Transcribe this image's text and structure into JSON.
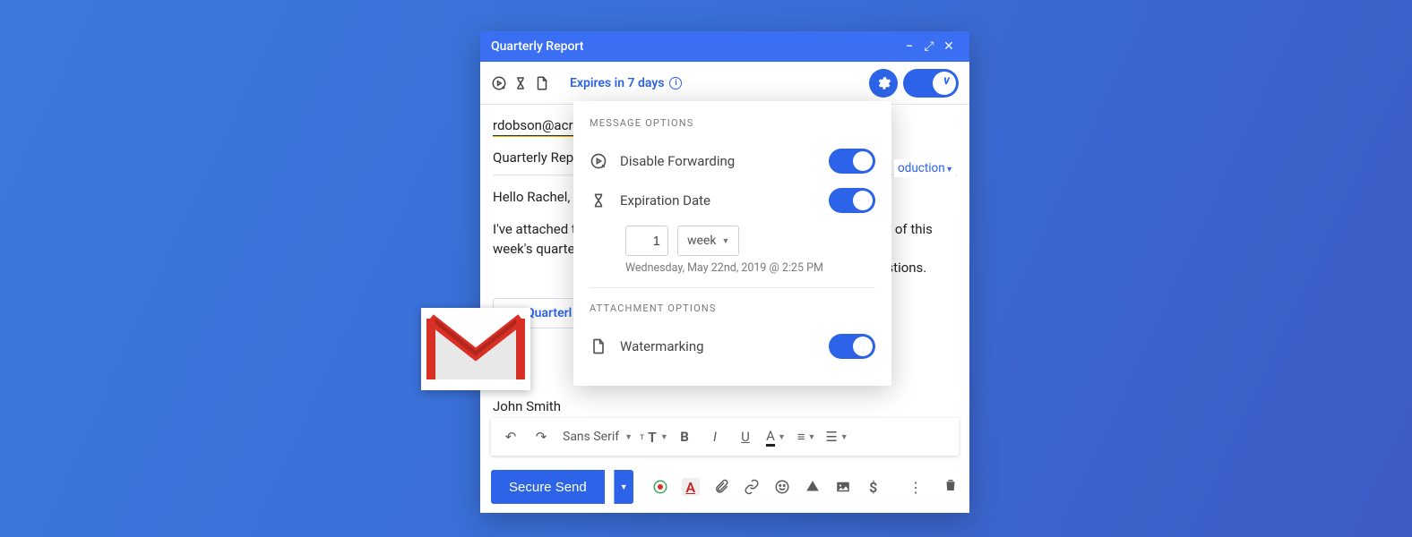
{
  "window": {
    "title": "Quarterly Report"
  },
  "toolbar": {
    "expires_label": "Expires in 7 days"
  },
  "compose": {
    "recipient": "rdobson@acr",
    "subject": "Quarterly Rep",
    "greeting": "Hello Rachel,",
    "body_part1": "I've attached th",
    "body_part2": "ad of this week's quarter",
    "body_part3": "estions.",
    "attachment_name": "Quarterl",
    "signature": "John Smith"
  },
  "format": {
    "font_label": "Sans Serif"
  },
  "send": {
    "button_label": "Secure Send"
  },
  "popover": {
    "message_section": "MESSAGE OPTIONS",
    "disable_forwarding": "Disable Forwarding",
    "expiration_date": "Expiration Date",
    "exp_value": "1",
    "exp_unit": "week",
    "exp_datetime": "Wednesday, May 22nd, 2019 @ 2:25 PM",
    "attachment_section": "ATTACHMENT OPTIONS",
    "watermarking": "Watermarking"
  },
  "intro_tag": "oduction"
}
